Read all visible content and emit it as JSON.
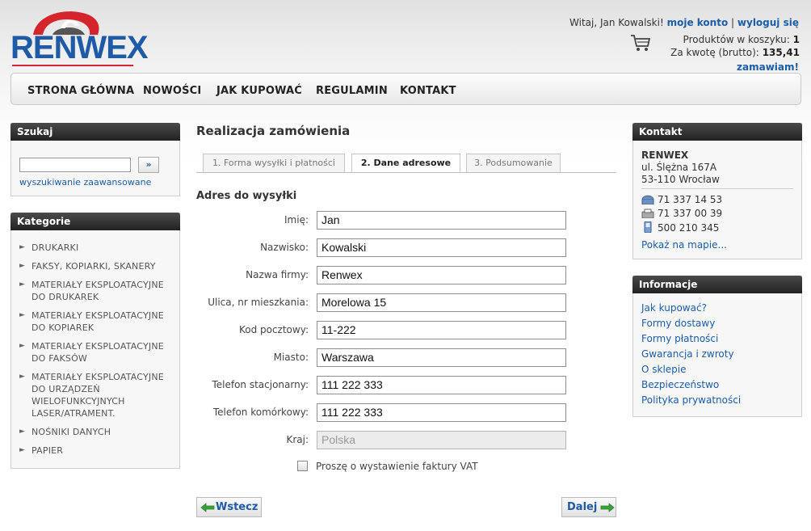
{
  "brand": {
    "name": "RENWEX"
  },
  "header": {
    "greeting": "Witaj, Jan Kowalski!",
    "account_link": "moje konto",
    "separator": "|",
    "logout_link": "wyloguj się",
    "cart_products_label": "Produktów w koszyku:",
    "cart_products_count": "1",
    "cart_total_label": "Za kwotę (brutto):",
    "cart_total_value": "135,41",
    "order_link": "zamawiam!"
  },
  "nav": {
    "items": [
      "STRONA GŁÓWNA",
      "NOWOŚCI",
      "JAK KUPOWAĆ",
      "REGULAMIN",
      "KONTAKT"
    ]
  },
  "search": {
    "title": "Szukaj",
    "query": "",
    "button": "»",
    "advanced_link": "wyszukiwanie zaawansowane"
  },
  "categories": {
    "title": "Kategorie",
    "items": [
      "DRUKARKI",
      "FAKSY, KOPIARKI, SKANERY",
      "MATERIAŁY EKSPLOATACYJNE DO DRUKAREK",
      "MATERIAŁY EKSPLOATACYJNE DO KOPIAREK",
      "MATERIAŁY EKSPLOATACYJNE DO FAKSÓW",
      "MATERIAŁY EKSPLOATACYJNE DO URZĄDZEŃ WIELOFUNKCYJNYCH LASER/ATRAMENT.",
      "NOŚNIKI DANYCH",
      "PAPIER"
    ]
  },
  "main": {
    "title": "Realizacja zamówienia",
    "tabs": [
      {
        "label": "1. Forma wysyłki i płatności",
        "active": false
      },
      {
        "label": "2. Dane adresowe",
        "active": true
      },
      {
        "label": "3. Podsumowanie",
        "active": false
      }
    ],
    "section_title": "Adres do wysyłki",
    "fields": [
      {
        "label": "Imię:",
        "value": "Jan"
      },
      {
        "label": "Nazwisko:",
        "value": "Kowalski"
      },
      {
        "label": "Nazwa firmy:",
        "value": "Renwex"
      },
      {
        "label": "Ulica, nr mieszkania:",
        "value": "Morelowa 15"
      },
      {
        "label": "Kod pocztowy:",
        "value": "11-222"
      },
      {
        "label": "Miasto:",
        "value": "Warszawa"
      },
      {
        "label": "Telefon stacjonarny:",
        "value": "111 222 333"
      },
      {
        "label": "Telefon komórkowy:",
        "value": "111 222 333"
      },
      {
        "label": "Kraj:",
        "value": "Polska",
        "disabled": true
      }
    ],
    "vat_label": "Proszę o wystawienie faktury VAT",
    "vat_checked": false,
    "back_button": "Wstecz",
    "next_button": "Dalej"
  },
  "contact": {
    "title": "Kontakt",
    "company": "RENWEX",
    "street": "ul. Ślężna 167A",
    "city": "53-110 Wrocław",
    "phone": "71 337 14 53",
    "fax": "71 337 00 39",
    "mobile": "500 210 345",
    "map_link": "Pokaż na mapie..."
  },
  "info": {
    "title": "Informacje",
    "links": [
      "Jak kupować?",
      "Formy dostawy",
      "Formy płatności",
      "Gwarancja i zwroty",
      "O sklepie",
      "Bezpieczeństwo",
      "Polityka prywatności"
    ]
  },
  "colors": {
    "link": "#1c5ca8",
    "logo_blue": "#1f5aa6",
    "logo_red": "#d5252c",
    "box_header": "#2b2b2b",
    "arrow_green": "#3aa13a"
  }
}
